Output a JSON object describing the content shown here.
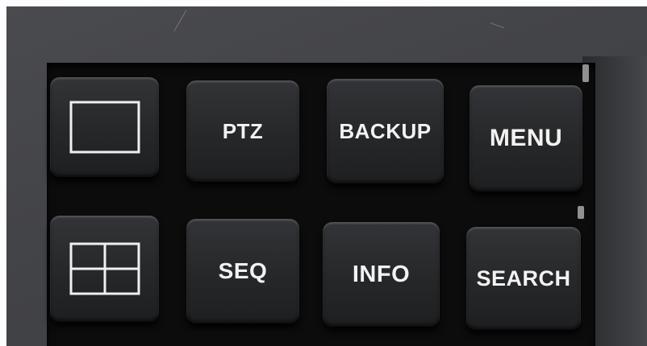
{
  "keypad": {
    "row1": [
      {
        "icon": "single-screen-icon",
        "label": ""
      },
      {
        "label": "PTZ"
      },
      {
        "label": "BACKUP"
      },
      {
        "label": "MENU"
      }
    ],
    "row2": [
      {
        "icon": "quad-screen-icon",
        "label": ""
      },
      {
        "label": "SEQ"
      },
      {
        "label": "INFO"
      },
      {
        "label": "SEARCH"
      }
    ]
  }
}
